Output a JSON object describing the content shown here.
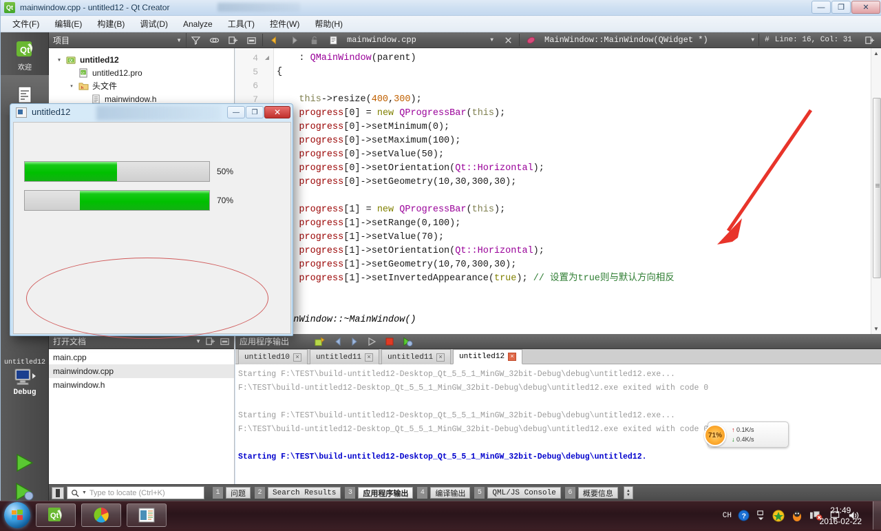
{
  "window": {
    "title": "mainwindow.cpp - untitled12 - Qt Creator",
    "minimize": "—",
    "maximize": "❐",
    "close": "✕"
  },
  "menubar": {
    "items": [
      {
        "label": "文件(F)"
      },
      {
        "label": "编辑(E)"
      },
      {
        "label": "构建(B)"
      },
      {
        "label": "调试(D)"
      },
      {
        "label": "Analyze"
      },
      {
        "label": "工具(T)"
      },
      {
        "label": "控件(W)"
      },
      {
        "label": "帮助(H)"
      }
    ]
  },
  "modebar": {
    "welcome_label": "欢迎",
    "kit_project": "untitled12",
    "kit_mode": "Debug"
  },
  "toolbar": {
    "project_combo": "项目",
    "file_combo": "mainwindow.cpp",
    "symbol_combo": "MainWindow::MainWindow(QWidget *)",
    "line_col": "Line: 16, Col: 31",
    "hash": "#"
  },
  "project_tree": {
    "items": [
      {
        "label": "untitled12",
        "depth": 0,
        "bold": true,
        "expander": "▾",
        "icon": "project-icon"
      },
      {
        "label": "untitled12.pro",
        "depth": 1,
        "bold": false,
        "expander": "",
        "icon": "pro-file-icon"
      },
      {
        "label": "头文件",
        "depth": 1,
        "bold": false,
        "expander": "▾",
        "icon": "folder-h-icon"
      },
      {
        "label": "mainwindow.h",
        "depth": 2,
        "bold": false,
        "expander": "",
        "icon": "header-file-icon"
      }
    ]
  },
  "editor": {
    "line_numbers": [
      "4",
      "5",
      "6",
      "7"
    ],
    "lines": [
      {
        "tokens": [
          {
            "t": "    : ",
            "c": "plain"
          },
          {
            "t": "QMainWindow",
            "c": "fn"
          },
          {
            "t": "(parent)",
            "c": "plain"
          }
        ]
      },
      {
        "tokens": [
          {
            "t": "{",
            "c": "plain"
          }
        ]
      },
      {
        "tokens": []
      },
      {
        "tokens": [
          {
            "t": "    ",
            "c": "plain"
          },
          {
            "t": "this",
            "c": "this"
          },
          {
            "t": "->resize(",
            "c": "plain"
          },
          {
            "t": "400",
            "c": "num"
          },
          {
            "t": ",",
            "c": "plain"
          },
          {
            "t": "300",
            "c": "num"
          },
          {
            "t": ");",
            "c": "plain"
          }
        ]
      },
      {
        "tokens": [
          {
            "t": "    ",
            "c": "plain"
          },
          {
            "t": "progress",
            "c": "id"
          },
          {
            "t": "[",
            "c": "plain"
          },
          {
            "t": "0",
            "c": "plain"
          },
          {
            "t": "] = ",
            "c": "plain"
          },
          {
            "t": "new",
            "c": "kw"
          },
          {
            "t": " ",
            "c": "plain"
          },
          {
            "t": "QProgressBar",
            "c": "fn"
          },
          {
            "t": "(",
            "c": "plain"
          },
          {
            "t": "this",
            "c": "this"
          },
          {
            "t": ");",
            "c": "plain"
          }
        ]
      },
      {
        "tokens": [
          {
            "t": "    ",
            "c": "plain"
          },
          {
            "t": "progress",
            "c": "id"
          },
          {
            "t": "[0]->setMinimum(",
            "c": "plain"
          },
          {
            "t": "0",
            "c": "plain"
          },
          {
            "t": ");",
            "c": "plain"
          }
        ]
      },
      {
        "tokens": [
          {
            "t": "    ",
            "c": "plain"
          },
          {
            "t": "progress",
            "c": "id"
          },
          {
            "t": "[0]->setMaximum(",
            "c": "plain"
          },
          {
            "t": "100",
            "c": "plain"
          },
          {
            "t": ");",
            "c": "plain"
          }
        ]
      },
      {
        "tokens": [
          {
            "t": "    ",
            "c": "plain"
          },
          {
            "t": "progress",
            "c": "id"
          },
          {
            "t": "[0]->setValue(",
            "c": "plain"
          },
          {
            "t": "50",
            "c": "plain"
          },
          {
            "t": ");",
            "c": "plain"
          }
        ]
      },
      {
        "tokens": [
          {
            "t": "    ",
            "c": "plain"
          },
          {
            "t": "progress",
            "c": "id"
          },
          {
            "t": "[0]->setOrientation(",
            "c": "plain"
          },
          {
            "t": "Qt::Horizontal",
            "c": "fn"
          },
          {
            "t": ");",
            "c": "plain"
          }
        ]
      },
      {
        "tokens": [
          {
            "t": "    ",
            "c": "plain"
          },
          {
            "t": "progress",
            "c": "id"
          },
          {
            "t": "[0]->setGeometry(",
            "c": "plain"
          },
          {
            "t": "10,30,300,30",
            "c": "plain"
          },
          {
            "t": ");",
            "c": "plain"
          }
        ]
      },
      {
        "tokens": []
      },
      {
        "tokens": [
          {
            "t": "    ",
            "c": "plain"
          },
          {
            "t": "progress",
            "c": "id"
          },
          {
            "t": "[1] = ",
            "c": "plain"
          },
          {
            "t": "new",
            "c": "kw"
          },
          {
            "t": " ",
            "c": "plain"
          },
          {
            "t": "QProgressBar",
            "c": "fn"
          },
          {
            "t": "(",
            "c": "plain"
          },
          {
            "t": "this",
            "c": "this"
          },
          {
            "t": ");",
            "c": "plain"
          }
        ]
      },
      {
        "tokens": [
          {
            "t": "    ",
            "c": "plain"
          },
          {
            "t": "progress",
            "c": "id"
          },
          {
            "t": "[1]->setRange(",
            "c": "plain"
          },
          {
            "t": "0,100",
            "c": "plain"
          },
          {
            "t": ");",
            "c": "plain"
          }
        ]
      },
      {
        "tokens": [
          {
            "t": "    ",
            "c": "plain"
          },
          {
            "t": "progress",
            "c": "id"
          },
          {
            "t": "[1]->setValue(",
            "c": "plain"
          },
          {
            "t": "70",
            "c": "plain"
          },
          {
            "t": ");",
            "c": "plain"
          }
        ]
      },
      {
        "tokens": [
          {
            "t": "    ",
            "c": "plain"
          },
          {
            "t": "progress",
            "c": "id"
          },
          {
            "t": "[1]->setOrientation(",
            "c": "plain"
          },
          {
            "t": "Qt::Horizontal",
            "c": "fn"
          },
          {
            "t": ");",
            "c": "plain"
          }
        ]
      },
      {
        "tokens": [
          {
            "t": "    ",
            "c": "plain"
          },
          {
            "t": "progress",
            "c": "id"
          },
          {
            "t": "[1]->setGeometry(",
            "c": "plain"
          },
          {
            "t": "10,70,300,30",
            "c": "plain"
          },
          {
            "t": ");",
            "c": "plain"
          }
        ]
      },
      {
        "tokens": [
          {
            "t": "    ",
            "c": "plain"
          },
          {
            "t": "progress",
            "c": "id"
          },
          {
            "t": "[1]->setInvertedAppearance(",
            "c": "plain"
          },
          {
            "t": "true",
            "c": "kw"
          },
          {
            "t": "); ",
            "c": "plain"
          },
          {
            "t": "// 设置为true则与默认方向相反",
            "c": "cmt"
          }
        ]
      },
      {
        "tokens": []
      },
      {
        "tokens": []
      },
      {
        "tokens": [
          {
            "t": "MainWindow::~MainWindow()",
            "c": "ital"
          }
        ]
      }
    ]
  },
  "app_window": {
    "title": "untitled12",
    "minimize": "—",
    "maximize": "❐",
    "close": "✕",
    "progress_bars": [
      {
        "value": 50,
        "label": "50%",
        "inverted": false
      },
      {
        "value": 70,
        "label": "70%",
        "inverted": true
      }
    ]
  },
  "open_documents": {
    "header": "打开文档",
    "items": [
      {
        "label": "main.cpp",
        "selected": false
      },
      {
        "label": "mainwindow.cpp",
        "selected": true
      },
      {
        "label": "mainwindow.h",
        "selected": false
      }
    ]
  },
  "application_output": {
    "header": "应用程序输出",
    "tabs": [
      {
        "label": "untitled10",
        "active": false
      },
      {
        "label": "untitled11",
        "active": false
      },
      {
        "label": "untitled11",
        "active": false
      },
      {
        "label": "untitled12",
        "active": true
      }
    ],
    "lines": [
      {
        "text": "Starting F:\\TEST\\build-untitled12-Desktop_Qt_5_5_1_MinGW_32bit-Debug\\debug\\untitled12.exe...",
        "style": "grey"
      },
      {
        "text": "F:\\TEST\\build-untitled12-Desktop_Qt_5_5_1_MinGW_32bit-Debug\\debug\\untitled12.exe exited with code 0",
        "style": "grey"
      },
      {
        "text": "",
        "style": "grey"
      },
      {
        "text": "Starting F:\\TEST\\build-untitled12-Desktop_Qt_5_5_1_MinGW_32bit-Debug\\debug\\untitled12.exe...",
        "style": "grey"
      },
      {
        "text": "F:\\TEST\\build-untitled12-Desktop_Qt_5_5_1_MinGW_32bit-Debug\\debug\\untitled12.exe exited with code 0",
        "style": "grey"
      },
      {
        "text": "",
        "style": "grey"
      },
      {
        "text": "Starting F:\\TEST\\build-untitled12-Desktop_Qt_5_5_1_MinGW_32bit-Debug\\debug\\untitled12.",
        "style": "blue"
      }
    ]
  },
  "statusbar": {
    "locator_placeholder": "Type to locate (Ctrl+K)",
    "tabs": [
      {
        "num": "1",
        "label": "问题",
        "active": false
      },
      {
        "num": "2",
        "label": "Search Results",
        "active": false
      },
      {
        "num": "3",
        "label": "应用程序输出",
        "active": true
      },
      {
        "num": "4",
        "label": "编译输出",
        "active": false
      },
      {
        "num": "5",
        "label": "QML/JS Console",
        "active": false
      },
      {
        "num": "6",
        "label": "概要信息",
        "active": false
      }
    ]
  },
  "network_float": {
    "percent": "71%",
    "up": "0.1K/s",
    "down": "0.4K/s"
  },
  "taskbar": {
    "time": "21:49",
    "date": "2016-02-22",
    "ime": "CH"
  }
}
